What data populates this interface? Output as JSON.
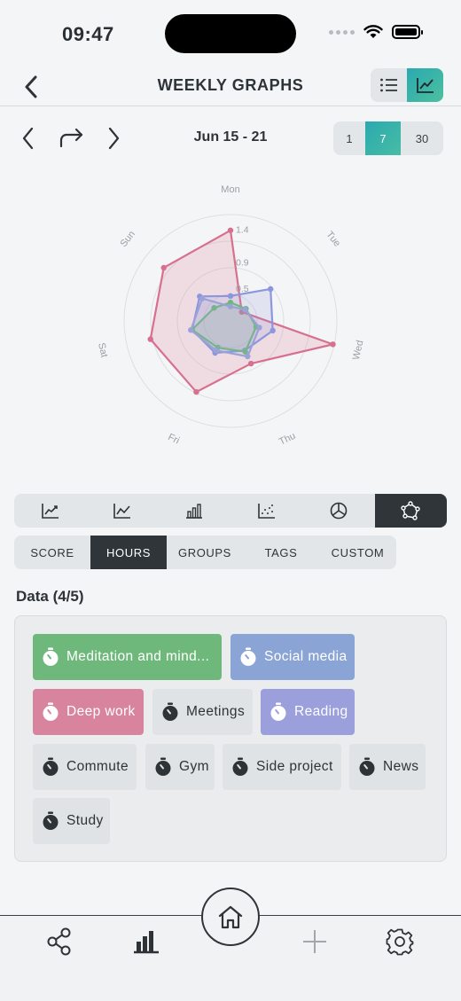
{
  "status": {
    "time": "09:47"
  },
  "header": {
    "title": "WEEKLY GRAPHS"
  },
  "nav": {
    "date_range": "Jun 15 - 21",
    "periods": [
      "1",
      "7",
      "30"
    ],
    "active_period": "7"
  },
  "chart_data": {
    "type": "radar",
    "axes": [
      "Mon",
      "Tue",
      "Wed",
      "Thu",
      "Fri",
      "Sat",
      "Sun"
    ],
    "tick_labels": [
      "1.4",
      "0.9",
      "0.5"
    ],
    "series": [
      {
        "name": "Deep work",
        "color": "#d7708f",
        "values": [
          1.38,
          0.22,
          1.6,
          0.72,
          1.2,
          1.25,
          1.3
        ]
      },
      {
        "name": "Social media",
        "color": "#8b96dc",
        "values": [
          0.38,
          0.78,
          0.66,
          0.5,
          0.54,
          0.6,
          0.6
        ]
      },
      {
        "name": "Meditation and mindfulness",
        "color": "#6fb87c",
        "values": [
          0.28,
          0.3,
          0.4,
          0.52,
          0.45,
          0.6,
          0.32
        ]
      },
      {
        "name": "Reading",
        "color": "#9aa2d6",
        "values": [
          0.22,
          0.28,
          0.45,
          0.6,
          0.5,
          0.62,
          0.55
        ]
      }
    ],
    "rmax": 1.62
  },
  "chart_types": [
    "area-chart-icon",
    "line-chart-icon",
    "bar-chart-icon",
    "scatter-chart-icon",
    "pie-chart-icon",
    "radar-chart-icon"
  ],
  "metric_tabs": [
    "SCORE",
    "HOURS",
    "GROUPS",
    "TAGS",
    "CUSTOM"
  ],
  "active_metric": "HOURS",
  "data_section": {
    "label": "Data (4/5)"
  },
  "chips": [
    {
      "label": "Meditation and mind...",
      "color": "#6fb87c",
      "selected": true
    },
    {
      "label": "Social media",
      "color": "#8aa4d6",
      "selected": true
    },
    {
      "label": "Deep work",
      "color": "#d8849f",
      "selected": true
    },
    {
      "label": "Meetings",
      "selected": false
    },
    {
      "label": "Reading",
      "color": "#9b9fdc",
      "selected": true
    },
    {
      "label": "Commute",
      "selected": false
    },
    {
      "label": "Gym",
      "selected": false
    },
    {
      "label": "Side project",
      "selected": false
    },
    {
      "label": "News",
      "selected": false
    },
    {
      "label": "Study",
      "selected": false
    }
  ],
  "accent": "#2aa9b0"
}
